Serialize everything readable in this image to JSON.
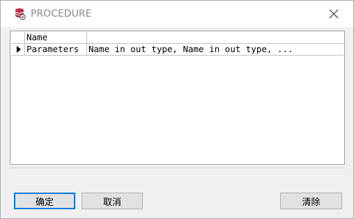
{
  "window": {
    "title": "PROCEDURE",
    "icon": "database-gear-icon",
    "close_icon": "close-icon"
  },
  "grid": {
    "header": {
      "name": "Name",
      "value": ""
    },
    "rows": [
      {
        "name": "Parameters",
        "value": "Name in out type, Name in out type, ...",
        "selected": true
      }
    ]
  },
  "buttons": {
    "ok_label": "确定",
    "cancel_label": "取消",
    "clear_label": "清除"
  },
  "colors": {
    "primary_border": "#0078d7",
    "icon_red": "#c0304a"
  }
}
